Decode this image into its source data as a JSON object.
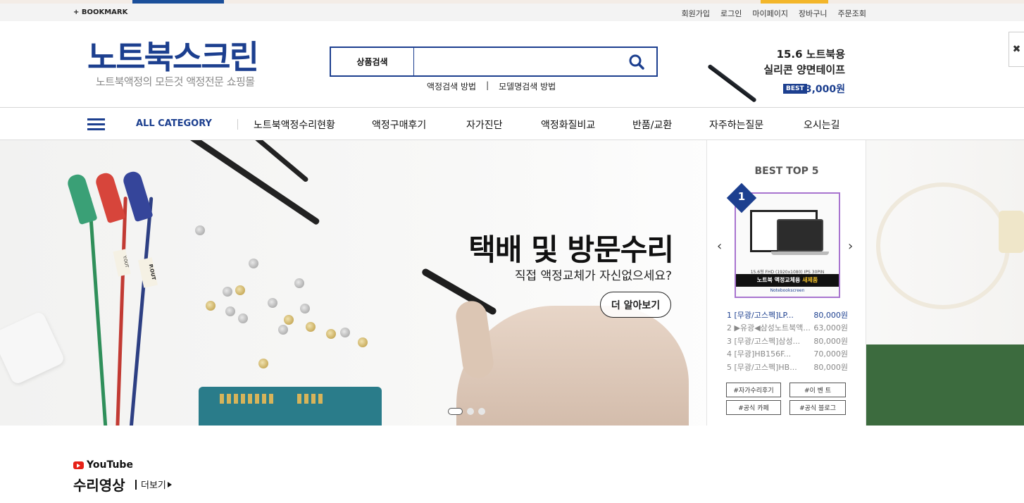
{
  "topbar": {
    "bookmark": "+ BOOKMARK",
    "links": [
      "회원가입",
      "로그인",
      "마이페이지",
      "장바구니",
      "주문조회"
    ]
  },
  "header": {
    "logo_main": "노트북스크린",
    "logo_sub": "노트북액정의 모든것 액정전문 쇼핑몰",
    "search_category": "상품검색",
    "search_placeholder": "",
    "search_help": [
      "액정검색 방법",
      "|",
      "모델명검색 방법"
    ],
    "promo": {
      "line1": "15.6 노트북용",
      "line2": "실리콘 양면테이프",
      "badge": "BEST",
      "price": "3,000원"
    },
    "close": "✖"
  },
  "nav": {
    "all_category": "ALL CATEGORY",
    "items": [
      "노트북액정수리현황",
      "액정구매후기",
      "자가진단",
      "액정화질비교",
      "반품/교환",
      "자주하는질문",
      "오시는길"
    ]
  },
  "hero": {
    "title": "택배 및 방문수리",
    "subtitle": "직접 액정교체가 자신없으세요?",
    "button": "더 알아보기",
    "dots": 3,
    "active_dot": 0,
    "labels": [
      "Y.OUT",
      "P.OUT"
    ]
  },
  "best": {
    "title": "BEST TOP 5",
    "rank": "1",
    "thumb_caption": "15.6형 FHD (1920x1080) IPS 30PIN",
    "thumb_band_a": "노트북 액정교체용",
    "thumb_band_b": "새제품",
    "thumb_brand": "Notebookscreen",
    "items": [
      {
        "name": "1 [무광/고스펙]LP...",
        "price": "80,000원"
      },
      {
        "name": "2 ▶유광◀삼성노트북액...",
        "price": "63,000원"
      },
      {
        "name": "3 [무광/고스펙]삼성...",
        "price": "80,000원"
      },
      {
        "name": "4 [무광]HB156F...",
        "price": "70,000원"
      },
      {
        "name": "5 [무광/고스펙]HB...",
        "price": "80,000원"
      }
    ],
    "tags": [
      "#자가수리후기",
      "#이 벤 트",
      "#공식 카페",
      "#공식 블로그"
    ]
  },
  "youtube": {
    "label": "YouTube",
    "section_title": "수리영상",
    "more": "더보기"
  },
  "colors": {
    "brand_blue": "#1c3f8f",
    "best_border": "#a874cf"
  }
}
